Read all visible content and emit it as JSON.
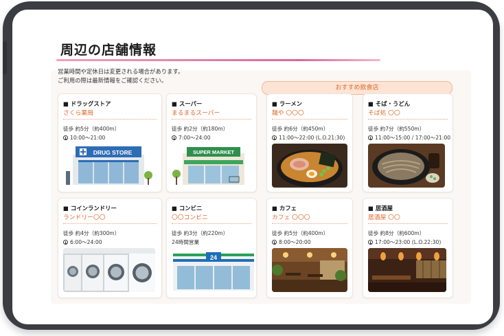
{
  "page": {
    "title": "周辺の店舗情報",
    "notice_line1": "営業時間や定休日は変更される場合があります。",
    "notice_line2": "ご利用の際は最新情報をご確認ください。",
    "recommend_label": "おすすめ飲食店"
  },
  "stores": [
    {
      "category": "■ ドラッグストア",
      "name": "さくら薬局",
      "walk": "徒歩 約5分（約400m）",
      "hours": "10:00〜21:00",
      "sign": "DRUG STORE",
      "icon": "drugstore-illustration"
    },
    {
      "category": "■ スーパー",
      "name": "まるまるスーパー",
      "walk": "徒歩 約2分（約180m）",
      "hours": "7:00〜24:00",
      "sign": "SUPER MARKET",
      "icon": "supermarket-illustration"
    },
    {
      "category": "■ ラーメン",
      "name": "麺や 〇〇〇",
      "walk": "徒歩 約6分（約450m）",
      "hours": "11:00〜22:00 (L.O.21:30)",
      "icon": "ramen-photo"
    },
    {
      "category": "■ そば・うどん",
      "name": "そば処 〇〇",
      "walk": "徒歩 約7分（約550m）",
      "hours": "11:00〜15:00 / 17:00〜21:00",
      "icon": "soba-photo"
    },
    {
      "category": "■ コインランドリー",
      "name": "ランドリー〇〇",
      "walk": "徒歩 約4分（約300m）",
      "hours": "6:00〜24:00",
      "icon": "laundry-photo"
    },
    {
      "category": "■ コンビニ",
      "name": "〇〇コンビニ",
      "walk": "徒歩 約3分（約220m）",
      "hours": "24時間営業",
      "sign": "24",
      "icon": "convenience-store-illustration"
    },
    {
      "category": "■ カフェ",
      "name": "カフェ 〇〇〇",
      "walk": "徒歩 約5分（約400m）",
      "hours": "8:00〜20:00",
      "icon": "cafe-photo"
    },
    {
      "category": "■ 居酒屋",
      "name": "居酒屋 〇〇",
      "walk": "徒歩 約8分（約600m）",
      "hours": "17:00〜23:00 (L.O.22:30)",
      "icon": "izakaya-photo"
    }
  ],
  "colors": {
    "accent": "#e06a2c",
    "frame": "#3b3d43",
    "underline": "#d9669a"
  }
}
